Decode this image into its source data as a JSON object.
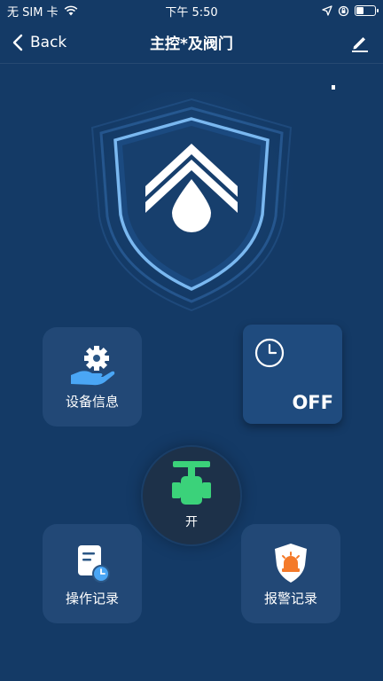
{
  "status_bar": {
    "carrier": "无 SIM 卡",
    "time": "下午 5:50",
    "battery_level": 0.35
  },
  "nav": {
    "back_label": "Back",
    "title": "主控*及阀门"
  },
  "tiles": {
    "device_info": "设备信息",
    "operation_log": "操作记录",
    "alarm_log": "报警记录"
  },
  "timer": {
    "state": "OFF"
  },
  "valve": {
    "label": "开"
  },
  "colors": {
    "background": "#143a66",
    "valve_green": "#3bd27a",
    "icon_blue": "#4aa6f5",
    "alarm_orange": "#f47a2a"
  },
  "icons": {
    "back": "chevron-left-icon",
    "edit": "pencil-icon",
    "device_info": "hand-gear-icon",
    "timer": "clock-icon",
    "valve": "valve-icon",
    "operation_log": "document-clock-icon",
    "alarm_log": "alarm-shield-icon",
    "center": "shield-water-drop-icon"
  }
}
